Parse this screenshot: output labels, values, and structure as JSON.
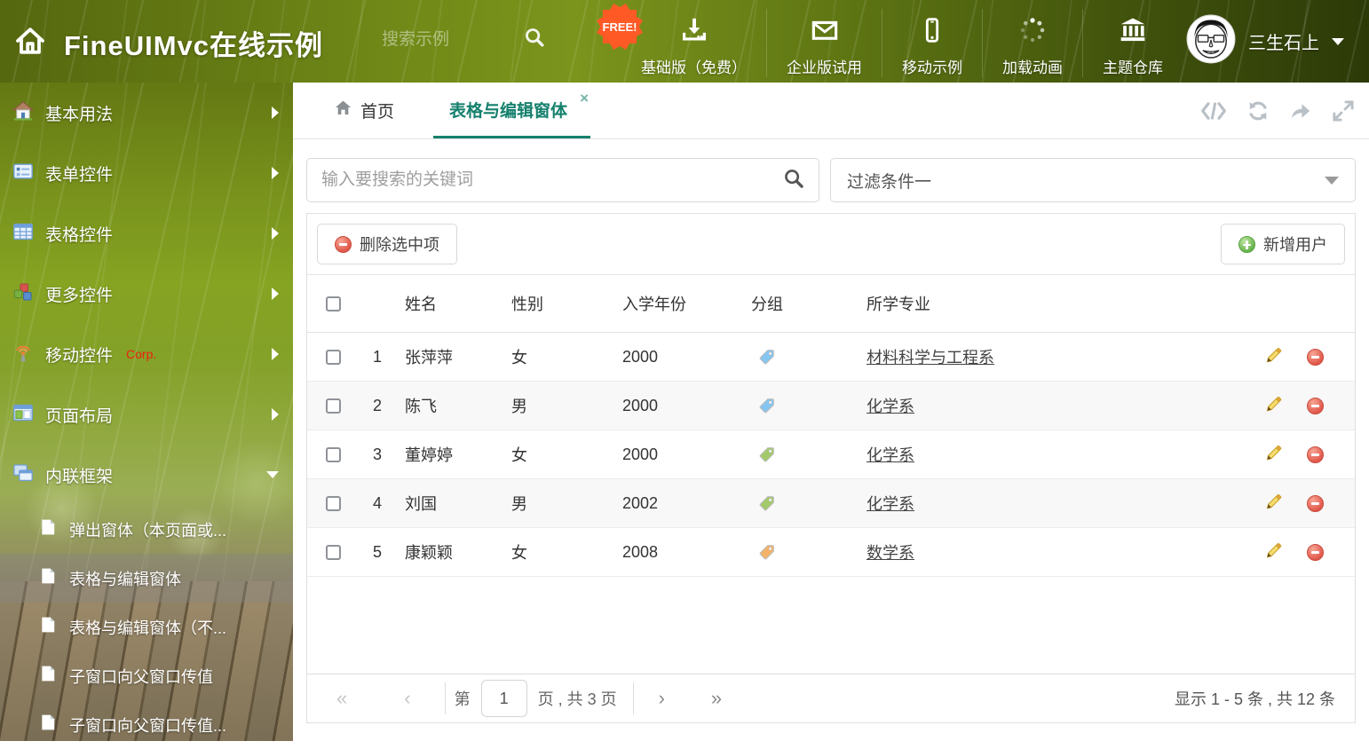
{
  "header": {
    "title": "FineUIMvc在线示例",
    "search_placeholder": "搜索示例",
    "free_badge": "FREE!",
    "nav": [
      {
        "label": "基础版（免费）",
        "icon": "download-icon"
      },
      {
        "label": "企业版试用",
        "icon": "envelope-icon"
      },
      {
        "label": "移动示例",
        "icon": "mobile-icon"
      },
      {
        "label": "加载动画",
        "icon": "spinner-icon"
      },
      {
        "label": "主题仓库",
        "icon": "bank-icon"
      }
    ],
    "user": {
      "name": "三生石上"
    }
  },
  "sidebar": {
    "items": [
      {
        "label": "基本用法",
        "icon": "house-icon"
      },
      {
        "label": "表单控件",
        "icon": "form-icon"
      },
      {
        "label": "表格控件",
        "icon": "grid-icon"
      },
      {
        "label": "更多控件",
        "icon": "cubes-icon"
      },
      {
        "label": "移动控件",
        "badge": "Corp.",
        "icon": "wireless-icon"
      },
      {
        "label": "页面布局",
        "icon": "layout-icon"
      },
      {
        "label": "内联框架",
        "icon": "frames-icon",
        "expanded": true
      }
    ],
    "subitems": [
      {
        "label": "弹出窗体（本页面或..."
      },
      {
        "label": "表格与编辑窗体",
        "selected": true
      },
      {
        "label": "表格与编辑窗体（不..."
      },
      {
        "label": "子窗口向父窗口传值"
      },
      {
        "label": "子窗口向父窗口传值..."
      }
    ]
  },
  "tabs": {
    "home_label": "首页",
    "active_label": "表格与编辑窗体",
    "close_glyph": "×"
  },
  "toolbar": {
    "search_placeholder": "输入要搜索的关键词",
    "filter_value": "过滤条件一",
    "delete_label": "删除选中项",
    "add_label": "新增用户"
  },
  "table": {
    "columns": [
      "姓名",
      "性别",
      "入学年份",
      "分组",
      "所学专业"
    ],
    "rows": [
      {
        "num": "1",
        "name": "张萍萍",
        "gender": "女",
        "year": "2000",
        "tag_color": "#85c5ef",
        "major": "材料科学与工程系"
      },
      {
        "num": "2",
        "name": "陈飞",
        "gender": "男",
        "year": "2000",
        "tag_color": "#85c5ef",
        "major": "化学系"
      },
      {
        "num": "3",
        "name": "董婷婷",
        "gender": "女",
        "year": "2000",
        "tag_color": "#a3c96a",
        "major": "化学系"
      },
      {
        "num": "4",
        "name": "刘国",
        "gender": "男",
        "year": "2002",
        "tag_color": "#a3c96a",
        "major": "化学系"
      },
      {
        "num": "5",
        "name": "康颖颖",
        "gender": "女",
        "year": "2008",
        "tag_color": "#f4b269",
        "major": "数学系"
      }
    ]
  },
  "pagination": {
    "first": "«",
    "prev": "‹",
    "page_label_prefix": "第",
    "page_value": "1",
    "page_label_suffix": "页 , 共 3 页",
    "next": "›",
    "last": "»",
    "summary": "显示 1 - 5 条 , 共 12 条"
  },
  "colors": {
    "accent": "#15806d",
    "free_badge": "#ff5a26",
    "delete_red": "#e0574a",
    "add_green": "#67b34c",
    "tag_blue": "#85c5ef",
    "tag_green": "#a3c96a",
    "tag_orange": "#f4b269"
  },
  "icons": {
    "app_home": "house",
    "top_search": "magnifier",
    "tab_tools": [
      "code",
      "refresh",
      "forward",
      "expand"
    ],
    "row_actions": [
      "pencil",
      "minus-circle"
    ],
    "group_tag": "tag"
  }
}
